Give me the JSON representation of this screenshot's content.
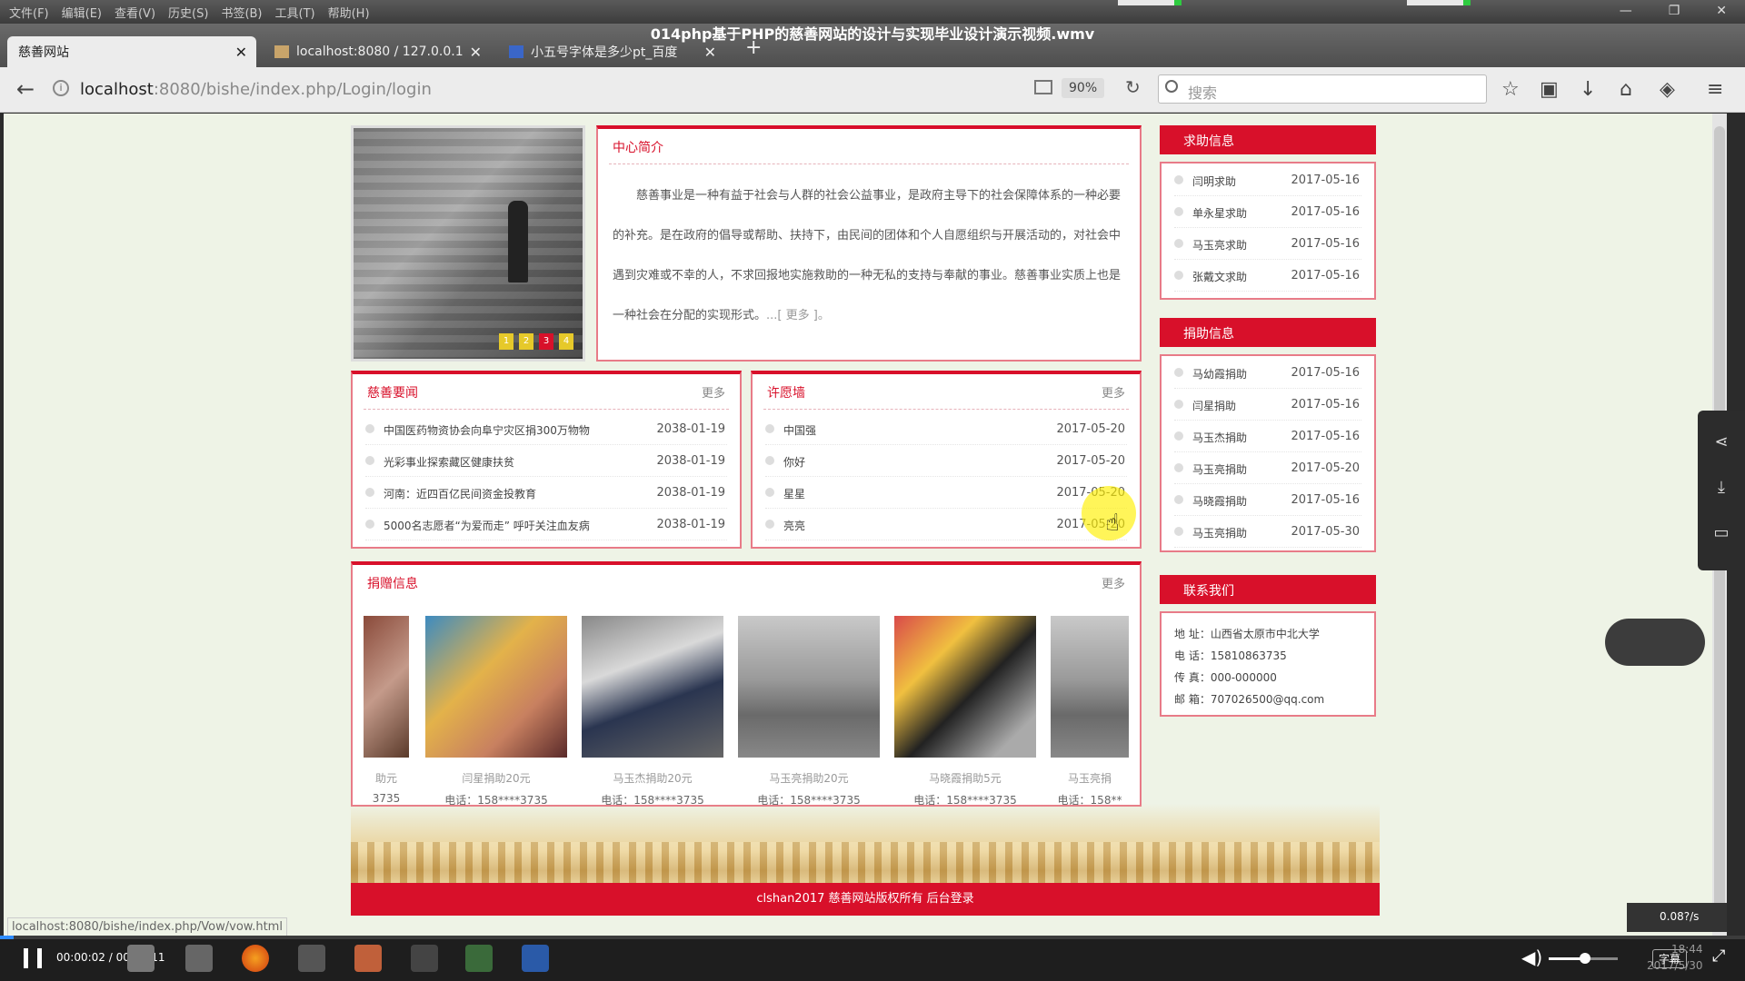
{
  "menus": [
    "文件(F)",
    "编辑(E)",
    "查看(V)",
    "历史(S)",
    "书签(B)",
    "工具(T)",
    "帮助(H)"
  ],
  "video_title": "014php基于PHP的慈善网站的设计与实现毕业设计演示视频.wmv",
  "tabs": [
    {
      "label": "慈善网站"
    },
    {
      "label": "localhost:8080 / 127.0.0.1"
    },
    {
      "label": "小五号字体是多少pt_百度"
    }
  ],
  "url": {
    "host": "localhost",
    "path": ":8080/bishe/index.php/Login/login"
  },
  "zoom": "90%",
  "search_placeholder": "搜索",
  "intro": {
    "title": "中心简介",
    "text": "慈善事业是一种有益于社会与人群的社会公益事业，是政府主导下的社会保障体系的一种必要的补充。是在政府的倡导或帮助、扶持下，由民间的团体和个人自愿组织与开展活动的，对社会中遇到灾难或不幸的人，不求回报地实施救助的一种无私的支持与奉献的事业。慈善事业实质上也是一种社会在分配的实现形式。",
    "more": "...[ 更多 ]。"
  },
  "slider_dots": [
    "1",
    "2",
    "3",
    "4"
  ],
  "news": {
    "title": "慈善要闻",
    "more": "更多",
    "items": [
      {
        "title": "中国医药物资协会向阜宁灾区捐300万物物",
        "date": "2038-01-19"
      },
      {
        "title": "光彩事业探索藏区健康扶贫",
        "date": "2038-01-19"
      },
      {
        "title": "河南：近四百亿民间资金投教育",
        "date": "2038-01-19"
      },
      {
        "title": "5000名志愿者“为爱而走” 呼吁关注血友病",
        "date": "2038-01-19"
      }
    ]
  },
  "wishes": {
    "title": "许愿墙",
    "more": "更多",
    "items": [
      {
        "title": "中国强",
        "date": "2017-05-20"
      },
      {
        "title": "你好",
        "date": "2017-05-20"
      },
      {
        "title": "星星",
        "date": "2017-05-20"
      },
      {
        "title": "亮亮",
        "date": "2017-05-20"
      }
    ]
  },
  "help": {
    "title": "求助信息",
    "items": [
      {
        "title": "闫明求助",
        "date": "2017-05-16"
      },
      {
        "title": "单永星求助",
        "date": "2017-05-16"
      },
      {
        "title": "马玉亮求助",
        "date": "2017-05-16"
      },
      {
        "title": "张戴文求助",
        "date": "2017-05-16"
      }
    ]
  },
  "donate_info": {
    "title": "捐助信息",
    "items": [
      {
        "title": "马幼霞捐助",
        "date": "2017-05-16"
      },
      {
        "title": "闫星捐助",
        "date": "2017-05-16"
      },
      {
        "title": "马玉杰捐助",
        "date": "2017-05-16"
      },
      {
        "title": "马玉亮捐助",
        "date": "2017-05-20"
      },
      {
        "title": "马晓霞捐助",
        "date": "2017-05-16"
      },
      {
        "title": "马玉亮捐助",
        "date": "2017-05-30"
      }
    ]
  },
  "donations": {
    "title": "捐赠信息",
    "more": "更多",
    "photos": [
      {
        "cap": "助元",
        "phone": "3735"
      },
      {
        "cap": "闫星捐助20元",
        "phone": "电话：158****3735"
      },
      {
        "cap": "马玉杰捐助20元",
        "phone": "电话：158****3735"
      },
      {
        "cap": "马玉亮捐助20元",
        "phone": "电话：158****3735"
      },
      {
        "cap": "马晓霞捐助5元",
        "phone": "电话：158****3735"
      },
      {
        "cap": "马玉亮捐",
        "phone": "电话：158**"
      }
    ]
  },
  "contact": {
    "title": "联系我们",
    "address": "地 址：山西省太原市中北大学",
    "phone": "电 话：15810863735",
    "fax": "传 真：000-000000",
    "email": "邮 箱：707026500@qq.com"
  },
  "footer": "clshan2017 慈善网站版权所有  后台登录",
  "status_url": "localhost:8080/bishe/index.php/Vow/vow.html",
  "player": {
    "time": "00:00:02 / 00:04:11",
    "subtitle": "字幕",
    "clock_time": "18:44",
    "clock_date": "2017/5/30",
    "speed": "0.08?/s",
    "progress": 0.008
  }
}
